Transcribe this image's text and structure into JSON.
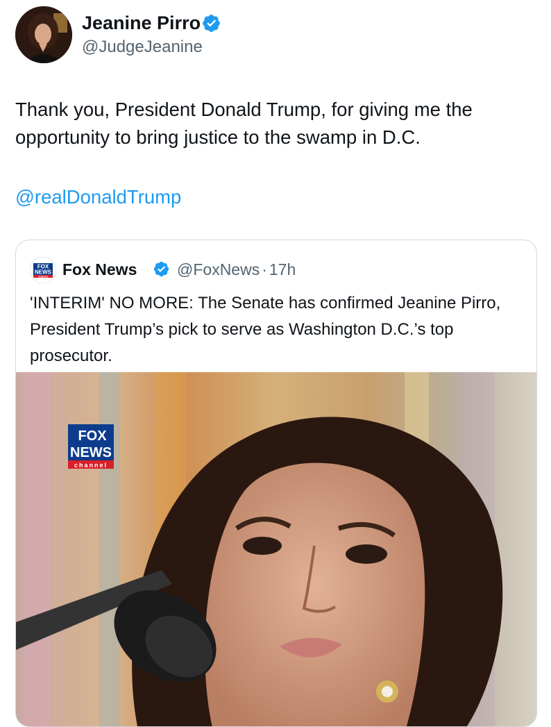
{
  "author": {
    "name": "Jeanine Pirro",
    "handle": "@JudgeJeanine"
  },
  "tweet": {
    "text": "Thank you, President Donald Trump, for giving me the opportunity to bring justice to the swamp in D.C.",
    "mention": "@realDonaldTrump"
  },
  "quoted": {
    "name": "Fox News",
    "handle": "@FoxNews",
    "separator": "·",
    "time": "17h",
    "text": "'INTERIM' NO MORE: The Senate has confirmed Jeanine Pirro, President Trump’s pick to serve as Washington D.C.’s top prosecutor.",
    "logo_text": {
      "line1": "FOX",
      "line2": "NEWS",
      "line3": "channel"
    }
  },
  "colors": {
    "link": "#1d9bf0",
    "verified": "#1d9bf0",
    "secondary_text": "#536471",
    "fox_blue": "#0d3c8c",
    "fox_red": "#d8202a"
  },
  "icons": {
    "verified": "verified-badge-icon"
  }
}
